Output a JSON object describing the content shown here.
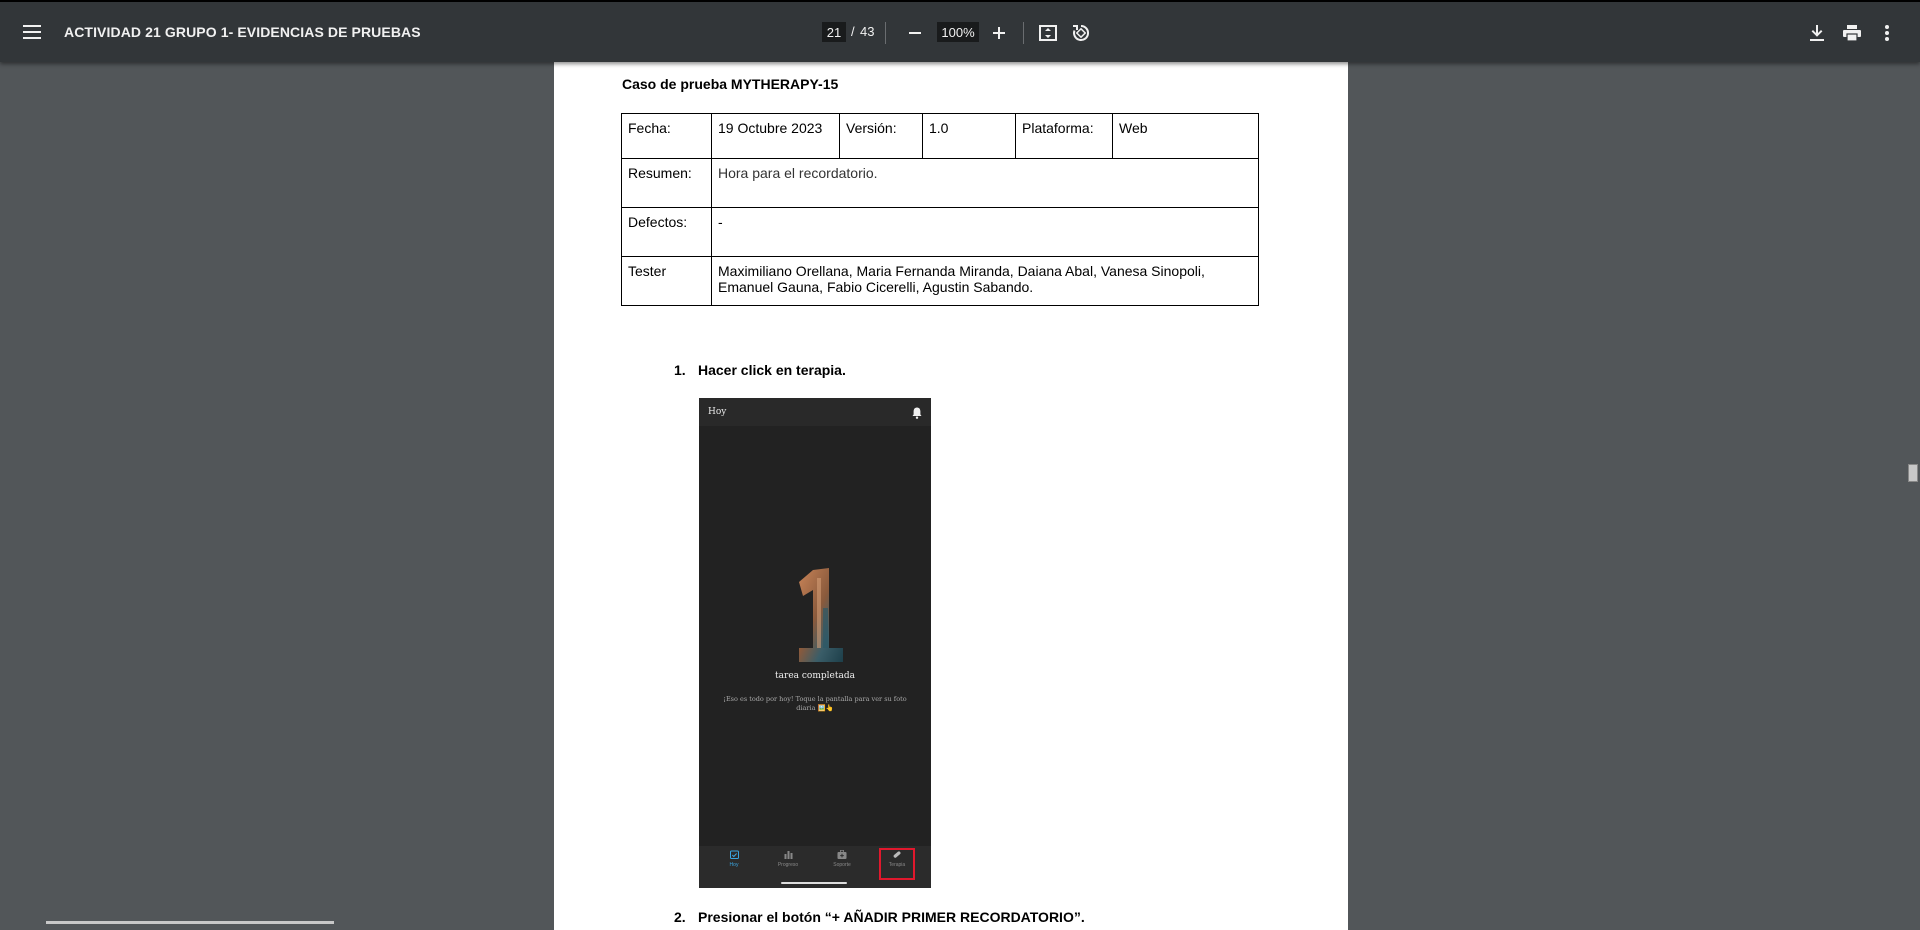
{
  "viewer": {
    "title": "ACTIVIDAD 21 GRUPO 1- EVIDENCIAS DE PRUEBAS",
    "current_page": "21",
    "page_separator": "/",
    "total_pages": "43",
    "zoom": "100%"
  },
  "document": {
    "case_title": "Caso de prueba MYTHERAPY-15",
    "table": {
      "fecha_label": "Fecha:",
      "fecha_value": "19 Octubre 2023",
      "version_label": "Versión:",
      "version_value": "1.0",
      "plataforma_label": "Plataforma:",
      "plataforma_value": "Web",
      "resumen_label": "Resumen:",
      "resumen_value": "Hora para el recordatorio.",
      "defectos_label": "Defectos:",
      "defectos_value": "-",
      "tester_label": "Tester",
      "tester_value": "Maximiliano Orellana, Maria Fernanda Miranda, Daiana Abal, Vanesa Sinopoli, Emanuel Gauna, Fabio Cicerelli, Agustin Sabando."
    },
    "steps": [
      {
        "number": "1.",
        "text": "Hacer click en terapia."
      },
      {
        "number": "2.",
        "text": "Presionar el botón “+ AÑADIR PRIMER RECORDATORIO”."
      }
    ],
    "phone": {
      "header_title": "Hoy",
      "completed_text": "tarea completada",
      "sub_text": "¡Eso es todo por hoy! Toque la pantalla para ver su foto diaria 🖼️👆",
      "nav": [
        "Hoy",
        "Progreso",
        "Soporte",
        "Terapia"
      ],
      "active_nav": "Hoy",
      "accent": "#3aa5e0",
      "highlight_color": "#e0182d"
    }
  }
}
